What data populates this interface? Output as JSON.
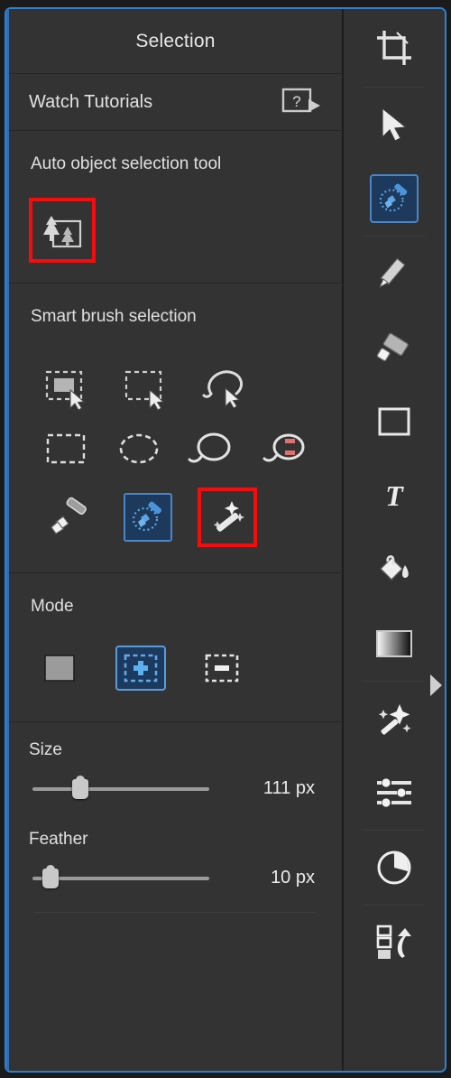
{
  "panel": {
    "title": "Selection",
    "tutorials": {
      "label": "Watch Tutorials",
      "icon": "help-video-icon"
    },
    "auto_object": {
      "heading": "Auto object selection tool",
      "tool_icon": "auto-object-selection-icon",
      "highlighted": true
    },
    "smart_brush": {
      "heading": "Smart brush selection",
      "tools": [
        {
          "name": "quick-selection-icon",
          "row": 1,
          "selected": false,
          "highlighted": false
        },
        {
          "name": "rectangular-select-cursor-icon",
          "row": 1,
          "selected": false,
          "highlighted": false
        },
        {
          "name": "lasso-cursor-icon",
          "row": 1,
          "selected": false,
          "highlighted": false
        },
        {
          "name": "rectangular-marquee-icon",
          "row": 2,
          "selected": false,
          "highlighted": false
        },
        {
          "name": "elliptical-marquee-icon",
          "row": 2,
          "selected": false,
          "highlighted": false
        },
        {
          "name": "lasso-icon",
          "row": 2,
          "selected": false,
          "highlighted": false
        },
        {
          "name": "magnetic-lasso-icon",
          "row": 2,
          "selected": false,
          "highlighted": false
        },
        {
          "name": "selection-brush-icon",
          "row": 3,
          "selected": false,
          "highlighted": false
        },
        {
          "name": "quick-selection-brush-icon",
          "row": 3,
          "selected": true,
          "highlighted": false
        },
        {
          "name": "magic-wand-icon",
          "row": 3,
          "selected": false,
          "highlighted": true
        }
      ]
    },
    "mode": {
      "heading": "Mode",
      "options": [
        {
          "name": "new-selection-icon",
          "selected": false
        },
        {
          "name": "add-to-selection-icon",
          "selected": true
        },
        {
          "name": "subtract-from-selection-icon",
          "selected": false
        }
      ]
    },
    "size": {
      "label": "Size",
      "value": "111 px",
      "percent": 27
    },
    "feather": {
      "label": "Feather",
      "value": "10 px",
      "percent": 10
    }
  },
  "toolbar": {
    "items": [
      {
        "name": "crop-tool-icon",
        "selected": false,
        "divider_after": true
      },
      {
        "name": "move-tool-icon",
        "selected": false,
        "divider_after": false
      },
      {
        "name": "quick-selection-tool-icon",
        "selected": true,
        "divider_after": true
      },
      {
        "name": "pencil-tool-icon",
        "selected": false,
        "divider_after": false
      },
      {
        "name": "eraser-tool-icon",
        "selected": false,
        "divider_after": false
      },
      {
        "name": "shape-tool-icon",
        "selected": false,
        "divider_after": false
      },
      {
        "name": "text-tool-icon",
        "selected": false,
        "divider_after": false
      },
      {
        "name": "paint-bucket-tool-icon",
        "selected": false,
        "divider_after": false
      },
      {
        "name": "gradient-tool-icon",
        "selected": false,
        "divider_after": true
      },
      {
        "name": "effects-tool-icon",
        "selected": false,
        "divider_after": false
      },
      {
        "name": "adjustments-tool-icon",
        "selected": false,
        "divider_after": true
      },
      {
        "name": "color-wheel-tool-icon",
        "selected": false,
        "divider_after": true
      },
      {
        "name": "layers-arrange-tool-icon",
        "selected": false,
        "divider_after": false
      }
    ],
    "expander": "panel-expand-arrow-icon"
  },
  "colors": {
    "background": "#333333",
    "accent_blue": "#2f7fd1",
    "selected_fill": "#1d3a5c",
    "highlight_red": "#f50d0d",
    "text": "#e6e6e6"
  }
}
